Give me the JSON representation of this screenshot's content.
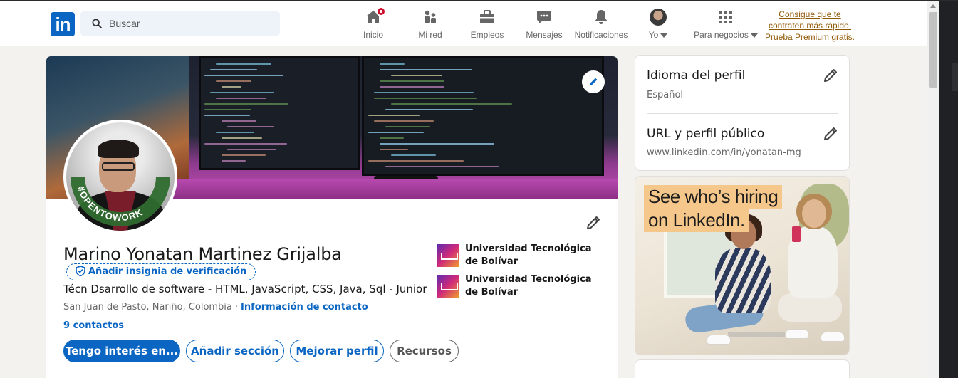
{
  "nav": {
    "logo_text": "in",
    "search_placeholder": "Buscar",
    "items": [
      {
        "label": "Inicio",
        "icon": "home-icon",
        "badge": true
      },
      {
        "label": "Mi red",
        "icon": "network-icon"
      },
      {
        "label": "Empleos",
        "icon": "briefcase-icon"
      },
      {
        "label": "Mensajes",
        "icon": "messaging-icon"
      },
      {
        "label": "Notificaciones",
        "icon": "bell-icon"
      },
      {
        "label": "Yo",
        "icon": "me-avatar"
      },
      {
        "label": "Para negocios",
        "icon": "grid-icon"
      }
    ],
    "premium_line1": "Consigue que te",
    "premium_line2": "contraten más rápido.",
    "premium_line3": "Prueba Premium gratis."
  },
  "profile": {
    "name": "Marino Yonatan Martinez Grijalba",
    "verify_label": "Añadir insignia de verificación",
    "headline": "Técn Dsarrollo de software - HTML, JavaScript, CSS, Java, Sql - Junior",
    "location": "San Juan de Pasto, Nariño, Colombia",
    "location_sep": "·",
    "contact_info": "Información de contacto",
    "connections": "9 contactos",
    "open_to_work": "#OPENTOWORK",
    "buttons": {
      "primary": "Tengo interés en...",
      "add_section": "Añadir sección",
      "improve": "Mejorar perfil",
      "resources": "Recursos"
    },
    "education": [
      {
        "name": "Universidad Tecnológica de Bolívar"
      },
      {
        "name": "Universidad Tecnológica de Bolívar"
      }
    ]
  },
  "sidebar": {
    "language_title": "Idioma del perfil",
    "language_value": "Español",
    "url_title": "URL y perfil público",
    "url_value": "www.linkedin.com/in/yonatan-mg"
  },
  "ad": {
    "line1": "See who’s hiring",
    "line2": "on LinkedIn."
  },
  "colors": {
    "brand": "#0a66c2",
    "premium": "#915907",
    "background": "#f4f2ee",
    "open_to_work": "#2f6b2f"
  }
}
